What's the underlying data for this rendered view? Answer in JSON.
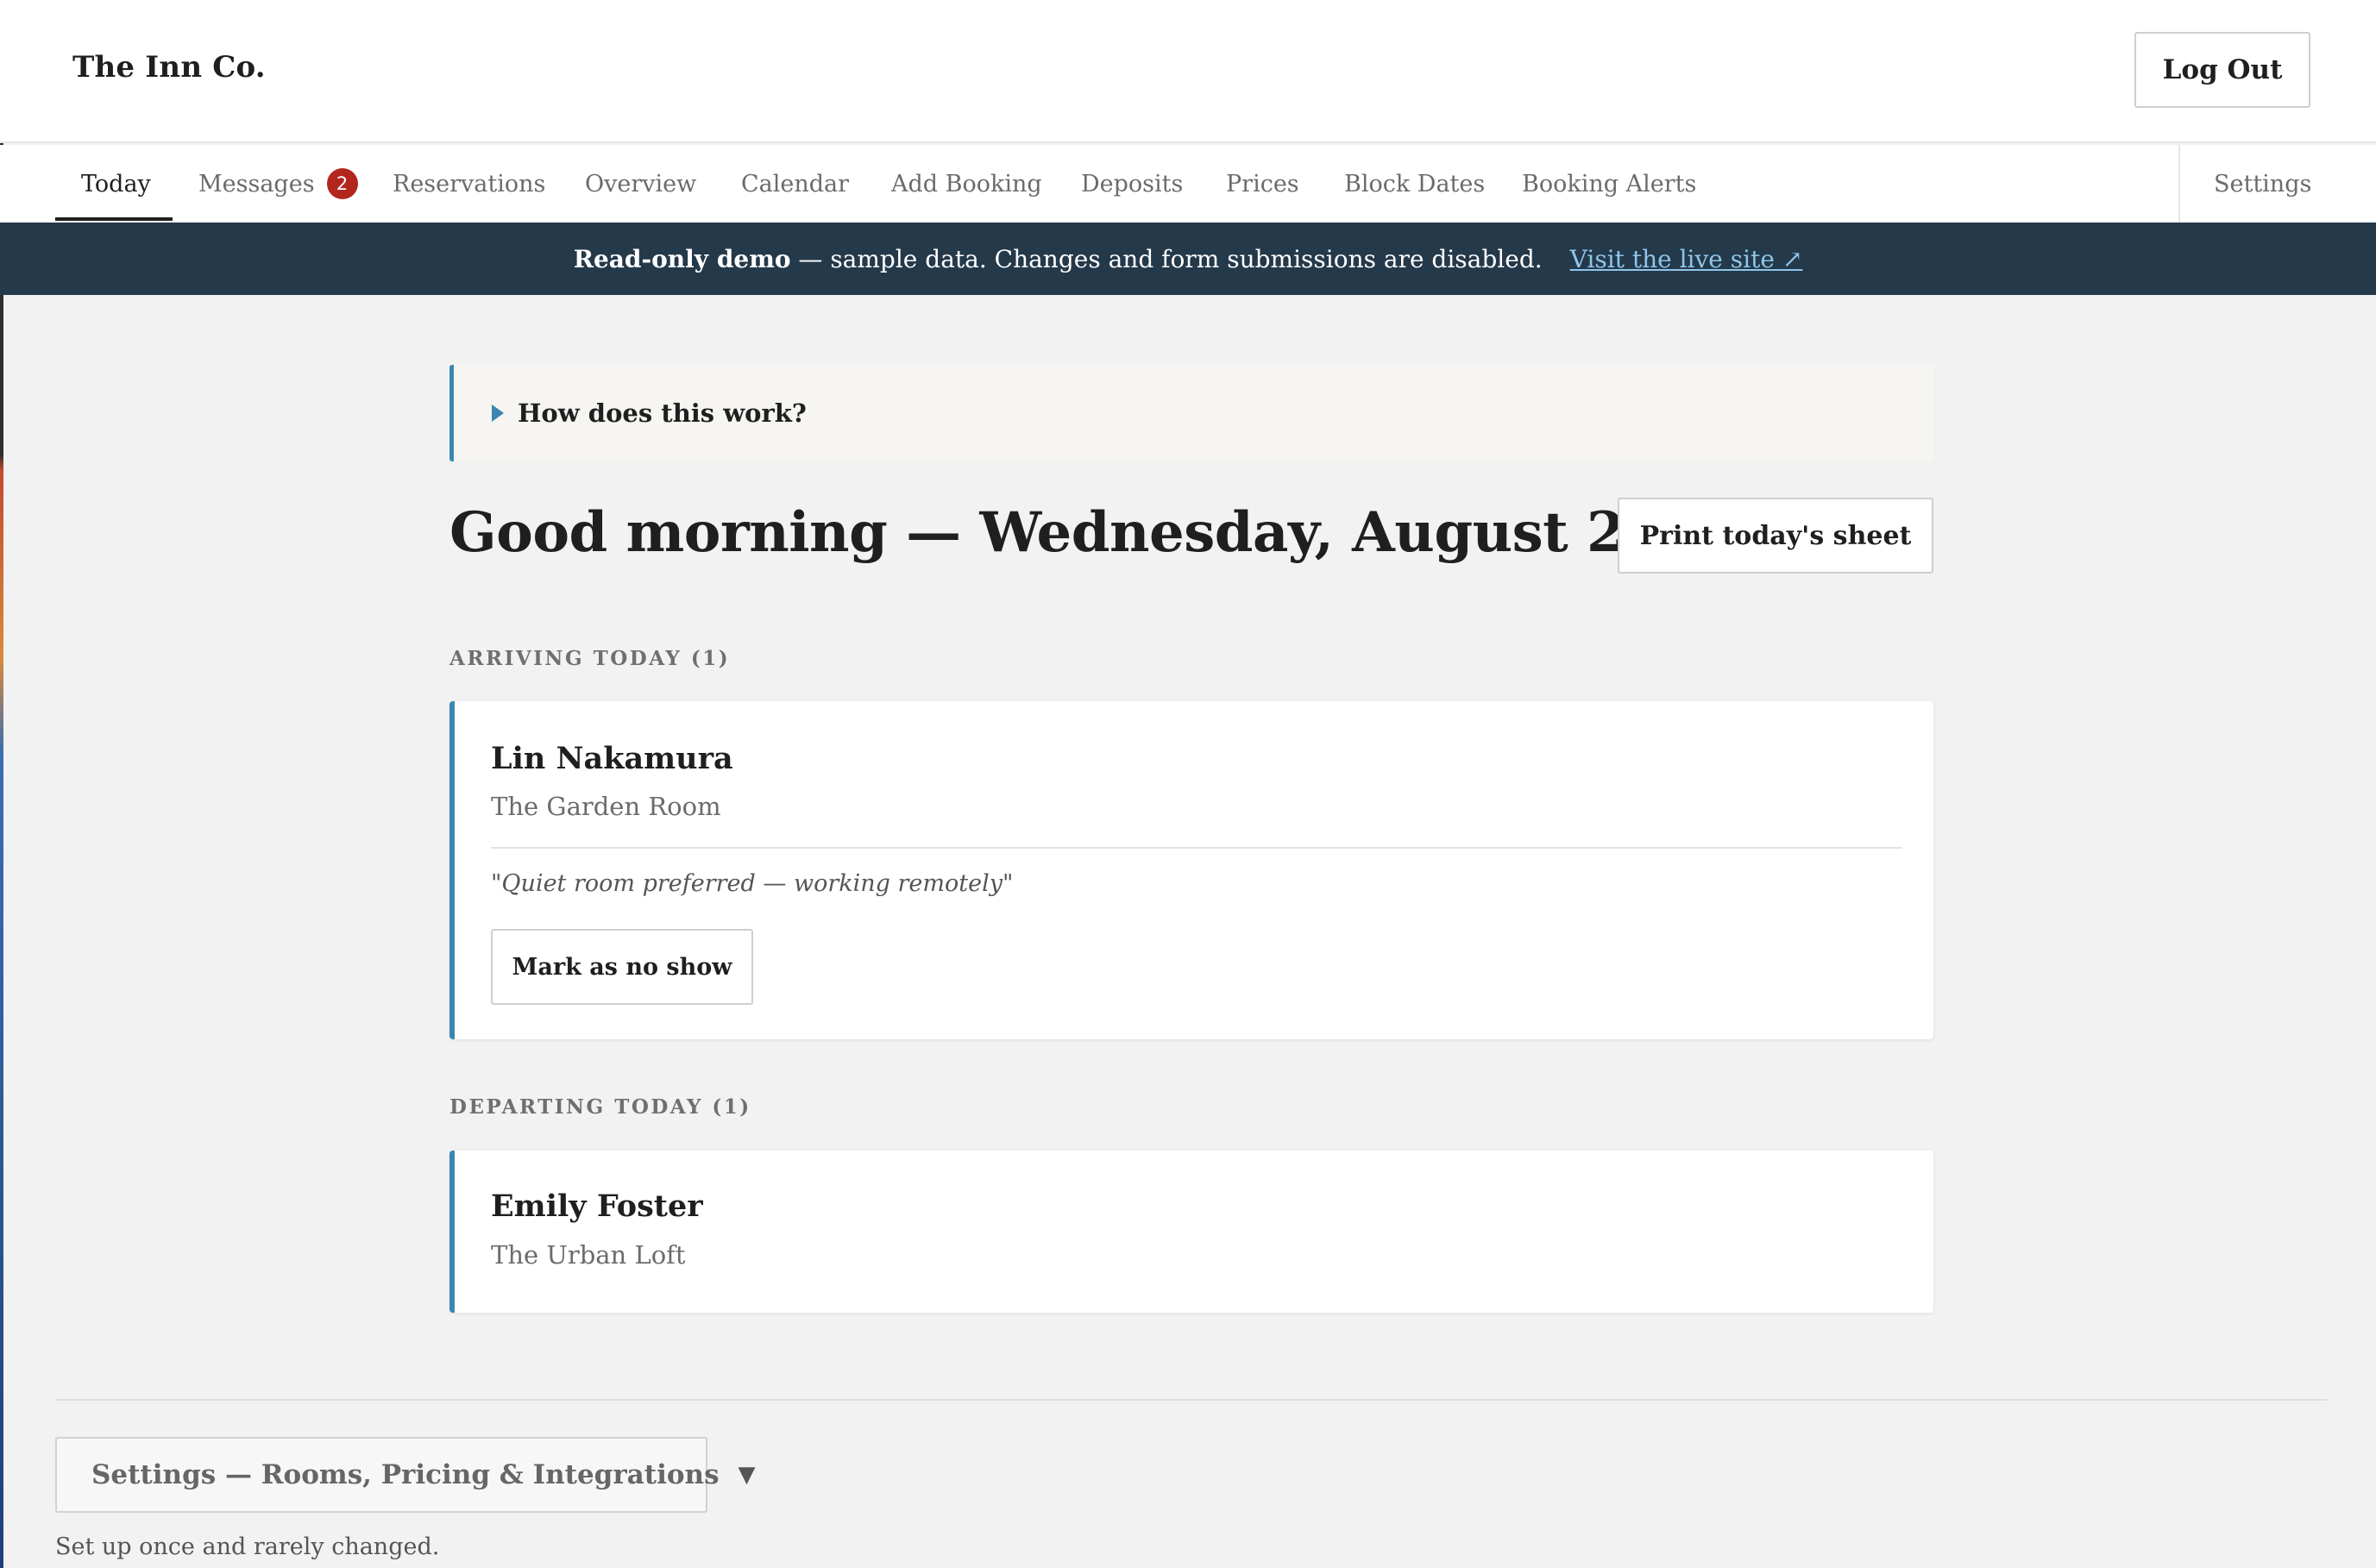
{
  "header": {
    "brand": "The Inn Co.",
    "logout_label": "Log Out"
  },
  "nav": {
    "items": [
      {
        "label": "Today",
        "active": true
      },
      {
        "label": "Messages",
        "badge": "2"
      },
      {
        "label": "Reservations"
      },
      {
        "label": "Overview"
      },
      {
        "label": "Calendar"
      },
      {
        "label": "Add Booking"
      },
      {
        "label": "Deposits"
      },
      {
        "label": "Prices"
      },
      {
        "label": "Block Dates"
      },
      {
        "label": "Booking Alerts"
      }
    ],
    "settings_label": "Settings"
  },
  "banner": {
    "strong": "Read-only demo",
    "text": " — sample data. Changes and form submissions are disabled.",
    "link_label": "Visit the live site ↗"
  },
  "help": {
    "label": "How does this work?"
  },
  "today": {
    "greeting": "Good morning — Wednesday, August 26",
    "print_label": "Print today's sheet"
  },
  "arriving": {
    "label": "ARRIVING TODAY (1)",
    "guests": [
      {
        "name": "Lin Nakamura",
        "room": "The Garden Room",
        "note": "\"Quiet room preferred — working remotely\"",
        "action_label": "Mark as no show"
      }
    ]
  },
  "departing": {
    "label": "DEPARTING TODAY (1)",
    "guests": [
      {
        "name": "Emily Foster",
        "room": "The Urban Loft"
      }
    ]
  },
  "footer": {
    "settings_toggle_label": "Settings — Rooms, Pricing & Integrations",
    "caret": "▼",
    "note": "Set up once and rarely changed."
  },
  "colors": {
    "accent": "#3b86b1",
    "banner_bg": "#24394a",
    "badge": "#b3261e",
    "link": "#8ec5ea"
  }
}
